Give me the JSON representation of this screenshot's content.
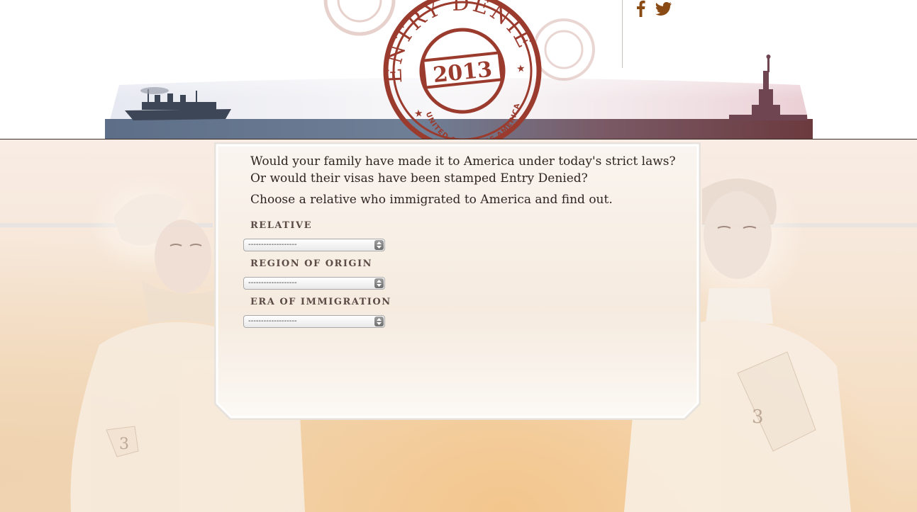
{
  "header": {
    "stamp": {
      "top_text": "ENTRY DENIED",
      "year": "2013",
      "bottom_text": "UNITED STATES OF AMERICA"
    },
    "social": [
      {
        "name": "facebook",
        "icon": "facebook-icon"
      },
      {
        "name": "twitter",
        "icon": "twitter-icon"
      }
    ]
  },
  "panel": {
    "intro_line1": "Would your family have made it to America under today's strict laws?",
    "intro_line2": "Or would their visas have been stamped Entry Denied?",
    "intro_line3": "Choose a relative who immigrated to America and find out.",
    "fields": [
      {
        "label": "RELATIVE",
        "selected": "-------------------"
      },
      {
        "label": "REGION OF ORIGIN",
        "selected": "-------------------"
      },
      {
        "label": "ERA OF IMMIGRATION",
        "selected": "-------------------"
      }
    ]
  },
  "colors": {
    "stamp_red": "#9a3b2e",
    "social_brown": "#8a4a13",
    "text_dark": "#2e2420"
  }
}
